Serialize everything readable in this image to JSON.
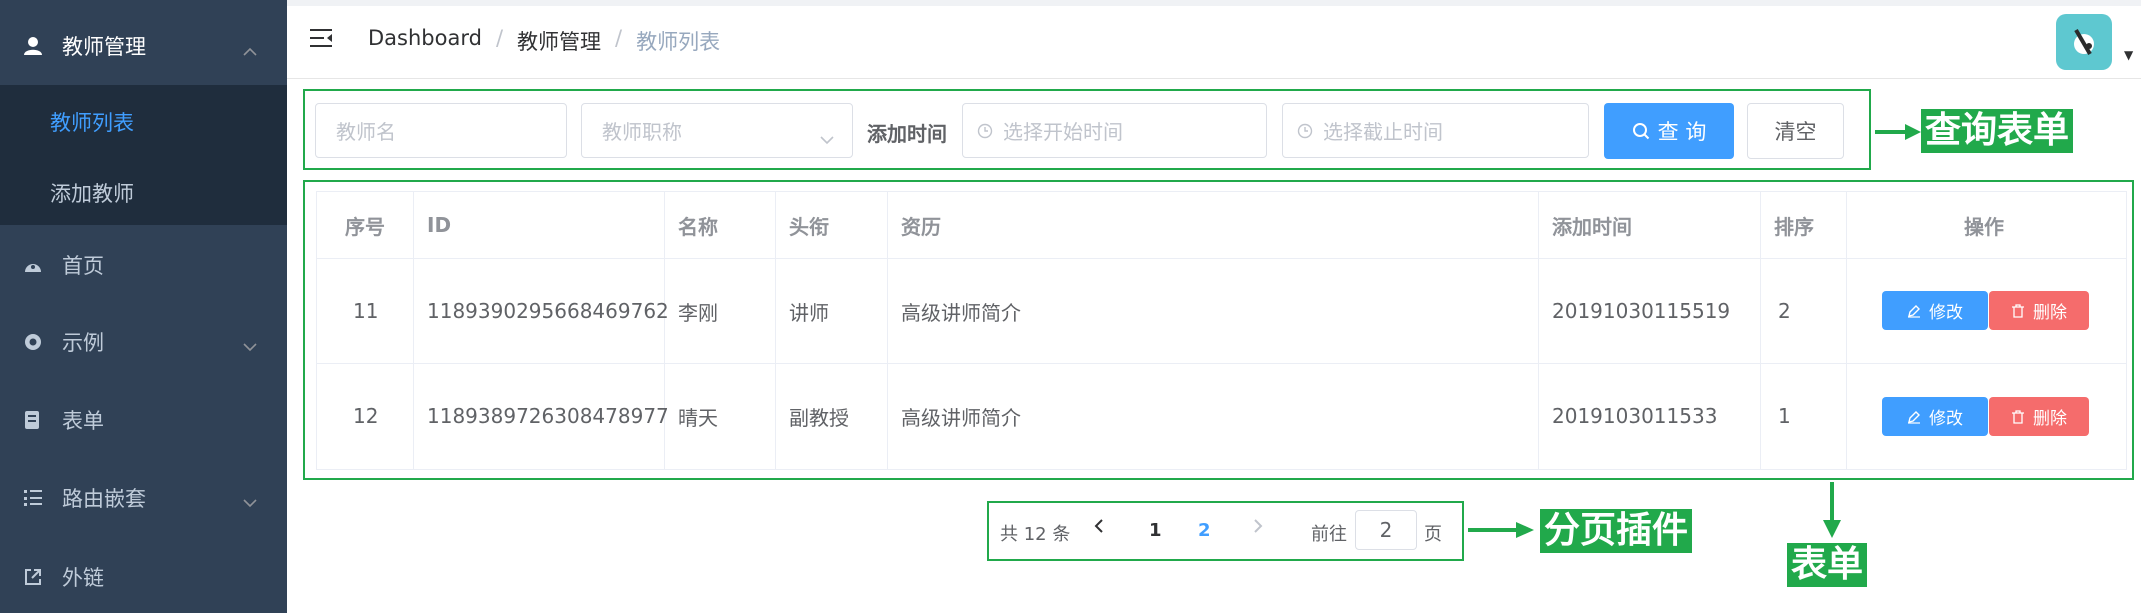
{
  "sidebar": {
    "menu_teacher": "教师管理",
    "sub_list": "教师列表",
    "sub_add": "添加教师",
    "home": "首页",
    "example": "示例",
    "form": "表单",
    "nested": "路由嵌套",
    "link": "外链"
  },
  "header": {
    "crumb_home": "Dashboard",
    "sep": "/",
    "crumb_mid": "教师管理",
    "crumb_last": "教师列表"
  },
  "query": {
    "name_placeholder": "教师名",
    "title_placeholder": "教师职称",
    "time_label": "添加时间",
    "start_placeholder": "选择开始时间",
    "end_placeholder": "选择截止时间",
    "search_label": "查 询",
    "clear_label": "清空"
  },
  "table": {
    "headers": [
      "序号",
      "ID",
      "名称",
      "头衔",
      "资历",
      "添加时间",
      "排序",
      "操作"
    ],
    "rows": [
      {
        "no": "11",
        "id": "1189390295668469762",
        "name": "李刚",
        "title": "讲师",
        "intro": "高级讲师简介",
        "time": "20191030115519",
        "sort": "2"
      },
      {
        "no": "12",
        "id": "1189389726308478977",
        "name": "晴天",
        "title": "副教授",
        "intro": "高级讲师简介",
        "time": "2019103011533",
        "sort": "1"
      }
    ],
    "edit_label": "修改",
    "delete_label": "删除"
  },
  "pagination": {
    "total_text": "共 12 条",
    "page1": "1",
    "page2": "2",
    "goto_prefix": "前往",
    "goto_value": "2",
    "goto_suffix": "页",
    "current_page": 2
  },
  "annotations": {
    "query_form": "查询表单",
    "pager": "分页插件",
    "table": "表单"
  },
  "colors": {
    "sidebar_bg": "#304156",
    "accent": "#409eff",
    "danger": "#f56c6c",
    "annotation": "#21a94b"
  }
}
